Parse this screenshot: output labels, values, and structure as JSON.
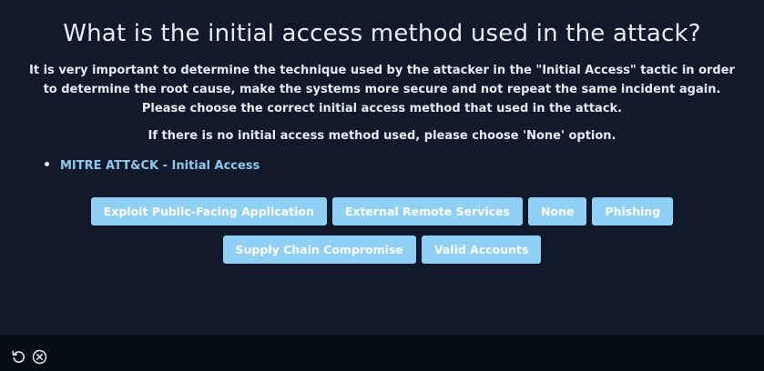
{
  "question": {
    "title": "What is the initial access method used in the attack?",
    "description": "It is very important to determine the technique used by the attacker in the \"Initial Access\" tactic in order to determine the root cause, make the systems more secure and not repeat the same incident again. Please choose the correct initial access method that used in the attack.",
    "note": "If there is no initial access method used, please choose 'None' option."
  },
  "references": [
    {
      "label": "MITRE ATT&CK - Initial Access"
    }
  ],
  "options": {
    "row1": [
      {
        "label": "Exploit Public-Facing Application"
      },
      {
        "label": "External Remote Services"
      },
      {
        "label": "None"
      },
      {
        "label": "Phishing"
      }
    ],
    "row2": [
      {
        "label": "Supply Chain Compromise"
      },
      {
        "label": "Valid Accounts"
      }
    ]
  },
  "footer": {
    "icons": [
      "undo-icon",
      "close-circle-icon"
    ]
  },
  "colors": {
    "background": "#111a2a",
    "footer": "#060c16",
    "option_button": "#8fd0f4",
    "link": "#8ec9ec"
  }
}
